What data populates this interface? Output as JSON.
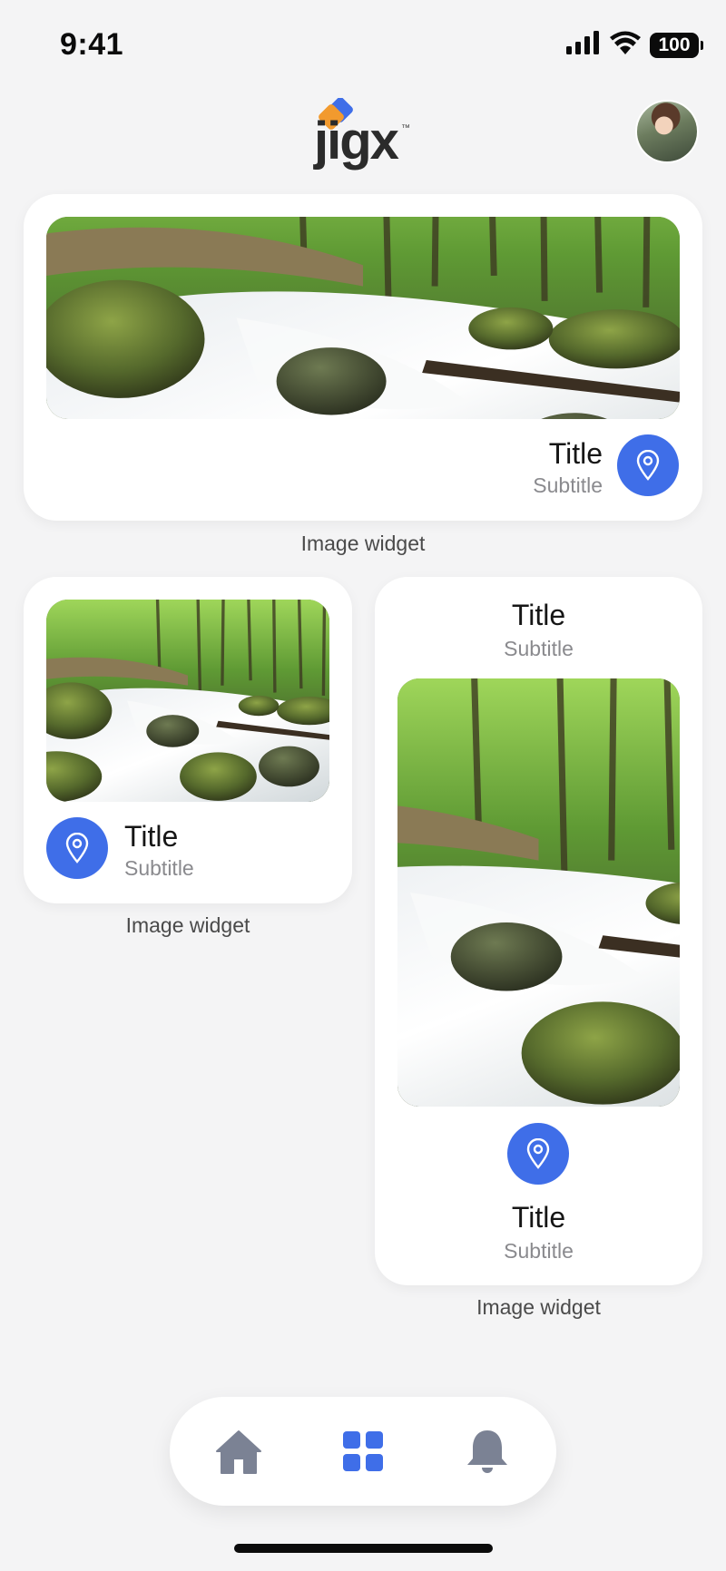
{
  "status_bar": {
    "time": "9:41",
    "battery": "100",
    "icons": [
      "signal-icon",
      "wifi-icon",
      "battery-icon"
    ]
  },
  "header": {
    "logo_text": "jigx",
    "logo_tm": "™",
    "avatar": "user-avatar"
  },
  "colors": {
    "accent": "#3f6ee8",
    "background": "#f4f4f5",
    "card": "#ffffff",
    "nav_icon_inactive": "#7b8294"
  },
  "widgets": [
    {
      "title": "Title",
      "subtitle": "Subtitle",
      "caption": "Image widget",
      "icon": "location-pin-icon"
    },
    {
      "title": "Title",
      "subtitle": "Subtitle",
      "caption": "Image widget",
      "icon": "location-pin-icon"
    },
    {
      "title": "Title",
      "subtitle": "Subtitle",
      "bottom_title": "Title",
      "bottom_subtitle": "Subtitle",
      "caption": "Image widget",
      "icon": "location-pin-icon"
    }
  ],
  "bottom_nav": [
    {
      "icon": "home-icon",
      "active": false
    },
    {
      "icon": "grid-icon",
      "active": true
    },
    {
      "icon": "bell-icon",
      "active": false
    }
  ]
}
